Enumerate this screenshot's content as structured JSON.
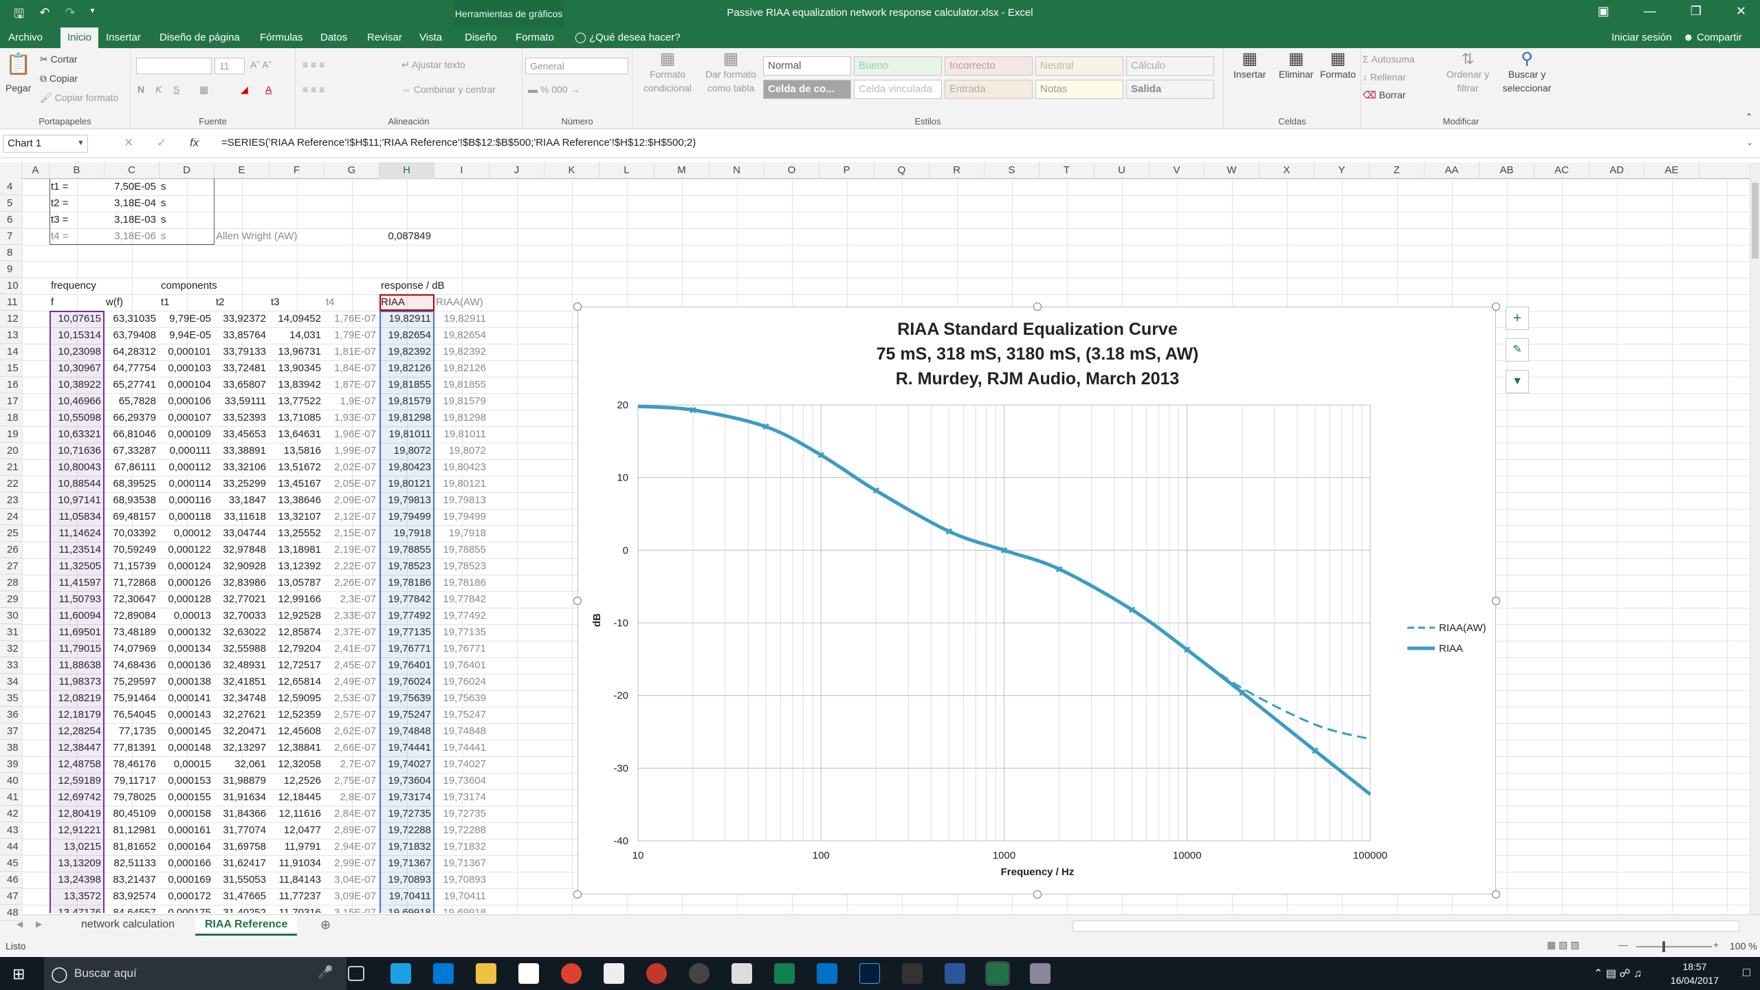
{
  "window": {
    "title": "Passive RIAA equalization network response calculator.xlsx - Excel",
    "context_tab": "Herramientas de gráficos"
  },
  "menu": {
    "tabs": [
      "Archivo",
      "Inicio",
      "Insertar",
      "Diseño de página",
      "Fórmulas",
      "Datos",
      "Revisar",
      "Vista",
      "Diseño",
      "Formato"
    ],
    "tell_me": "¿Qué desea hacer?",
    "signin": "Iniciar sesión",
    "share": "Compartir"
  },
  "ribbon": {
    "clipboard": {
      "paste": "Pegar",
      "cut": "Cortar",
      "copy": "Copiar",
      "format_painter": "Copiar formato",
      "group": "Portapapeles"
    },
    "font": {
      "size": "11",
      "group": "Fuente",
      "bold": "N",
      "italic": "K",
      "underline": "S"
    },
    "alignment": {
      "wrap": "Ajustar texto",
      "merge": "Combinar y centrar",
      "group": "Alineación"
    },
    "number": {
      "format": "General",
      "group": "Número"
    },
    "styles": {
      "conditional": "Formato condicional",
      "table": "Dar formato como tabla",
      "group": "Estilos",
      "cells": [
        "Normal",
        "Bueno",
        "Incorrecto",
        "Neutral",
        "Cálculo",
        "Celda de co...",
        "Celda vinculada",
        "Entrada",
        "Notas",
        "Salida"
      ]
    },
    "cells": {
      "insert": "Insertar",
      "delete": "Eliminar",
      "format": "Formato",
      "group": "Celdas"
    },
    "editing": {
      "autosum": "Autosuma",
      "fill": "Rellenar",
      "clear": "Borrar",
      "sort": "Ordenar y filtrar",
      "find": "Buscar y seleccionar",
      "group": "Modificar"
    }
  },
  "formula_bar": {
    "name_box": "Chart 1",
    "fx": "fx",
    "formula": "=SERIES('RIAA Reference'!$H$11;'RIAA Reference'!$B$12:$B$500;'RIAA Reference'!$H$12:$H$500;2)"
  },
  "columns": [
    "A",
    "B",
    "C",
    "D",
    "E",
    "F",
    "G",
    "H",
    "I",
    "J",
    "K",
    "L",
    "M",
    "N",
    "O",
    "P",
    "Q",
    "R",
    "S",
    "T",
    "U",
    "V",
    "W",
    "X",
    "Y",
    "Z",
    "AA",
    "AB",
    "AC",
    "AD",
    "AE"
  ],
  "row_numbers": [
    "4",
    "5",
    "6",
    "7",
    "8",
    "9",
    "10",
    "11",
    "12",
    "13",
    "14",
    "15",
    "16",
    "17",
    "18",
    "19",
    "20",
    "21",
    "22",
    "23",
    "24",
    "25",
    "26",
    "27",
    "28",
    "29",
    "30",
    "31",
    "32",
    "33",
    "34",
    "35",
    "36",
    "37",
    "38",
    "39",
    "40",
    "41",
    "42",
    "43",
    "44",
    "45",
    "46",
    "47",
    "48"
  ],
  "header_cells": {
    "t1_label": "t1 =",
    "t1_val": "7,50E-05",
    "t1_unit": "s",
    "t2_label": "t2 =",
    "t2_val": "3,18E-04",
    "t2_unit": "s",
    "t3_label": "t3 =",
    "t3_val": "3,18E-03",
    "t3_unit": "s",
    "t4_label": "t4 =",
    "t4_val": "3,18E-06",
    "t4_unit": "s",
    "aw_label": "Allen Wright (AW)",
    "aw_val": "0,087849",
    "frequency": "frequency",
    "components": "components",
    "response": "response / dB",
    "col_f": "f",
    "col_wf": "w(f)",
    "col_t1": "t1",
    "col_t2": "t2",
    "col_t3": "t3",
    "col_t4": "t4",
    "col_riaa": "RIAA",
    "col_riaa_aw": "RIAA(AW)"
  },
  "rows": [
    [
      "10,07615",
      "63,31035",
      "9,79E-05",
      "33,92372",
      "14,09452",
      "1,76E-07",
      "19,82911",
      "19,82911"
    ],
    [
      "10,15314",
      "63,79408",
      "9,94E-05",
      "33,85764",
      "14,031",
      "1,79E-07",
      "19,82654",
      "19,82654"
    ],
    [
      "10,23098",
      "64,28312",
      "0,000101",
      "33,79133",
      "13,96731",
      "1,81E-07",
      "19,82392",
      "19,82392"
    ],
    [
      "10,30967",
      "64,77754",
      "0,000103",
      "33,72481",
      "13,90345",
      "1,84E-07",
      "19,82126",
      "19,82126"
    ],
    [
      "10,38922",
      "65,27741",
      "0,000104",
      "33,65807",
      "13,83942",
      "1,87E-07",
      "19,81855",
      "19,81855"
    ],
    [
      "10,46966",
      "65,7828",
      "0,000106",
      "33,59111",
      "13,77522",
      "1,9E-07",
      "19,81579",
      "19,81579"
    ],
    [
      "10,55098",
      "66,29379",
      "0,000107",
      "33,52393",
      "13,71085",
      "1,93E-07",
      "19,81298",
      "19,81298"
    ],
    [
      "10,63321",
      "66,81046",
      "0,000109",
      "33,45653",
      "13,64631",
      "1,96E-07",
      "19,81011",
      "19,81011"
    ],
    [
      "10,71636",
      "67,33287",
      "0,000111",
      "33,38891",
      "13,5816",
      "1,99E-07",
      "19,8072",
      "19,8072"
    ],
    [
      "10,80043",
      "67,86111",
      "0,000112",
      "33,32106",
      "13,51672",
      "2,02E-07",
      "19,80423",
      "19,80423"
    ],
    [
      "10,88544",
      "68,39525",
      "0,000114",
      "33,25299",
      "13,45167",
      "2,05E-07",
      "19,80121",
      "19,80121"
    ],
    [
      "10,97141",
      "68,93538",
      "0,000116",
      "33,1847",
      "13,38646",
      "2,09E-07",
      "19,79813",
      "19,79813"
    ],
    [
      "11,05834",
      "69,48157",
      "0,000118",
      "33,11618",
      "13,32107",
      "2,12E-07",
      "19,79499",
      "19,79499"
    ],
    [
      "11,14624",
      "70,03392",
      "0,00012",
      "33,04744",
      "13,25552",
      "2,15E-07",
      "19,7918",
      "19,7918"
    ],
    [
      "11,23514",
      "70,59249",
      "0,000122",
      "32,97848",
      "13,18981",
      "2,19E-07",
      "19,78855",
      "19,78855"
    ],
    [
      "11,32505",
      "71,15739",
      "0,000124",
      "32,90928",
      "13,12392",
      "2,22E-07",
      "19,78523",
      "19,78523"
    ],
    [
      "11,41597",
      "71,72868",
      "0,000126",
      "32,83986",
      "13,05787",
      "2,26E-07",
      "19,78186",
      "19,78186"
    ],
    [
      "11,50793",
      "72,30647",
      "0,000128",
      "32,77021",
      "12,99166",
      "2,3E-07",
      "19,77842",
      "19,77842"
    ],
    [
      "11,60094",
      "72,89084",
      "0,00013",
      "32,70033",
      "12,92528",
      "2,33E-07",
      "19,77492",
      "19,77492"
    ],
    [
      "11,69501",
      "73,48189",
      "0,000132",
      "32,63022",
      "12,85874",
      "2,37E-07",
      "19,77135",
      "19,77135"
    ],
    [
      "11,79015",
      "74,07969",
      "0,000134",
      "32,55988",
      "12,79204",
      "2,41E-07",
      "19,76771",
      "19,76771"
    ],
    [
      "11,88638",
      "74,68436",
      "0,000136",
      "32,48931",
      "12,72517",
      "2,45E-07",
      "19,76401",
      "19,76401"
    ],
    [
      "11,98373",
      "75,29597",
      "0,000138",
      "32,41851",
      "12,65814",
      "2,49E-07",
      "19,76024",
      "19,76024"
    ],
    [
      "12,08219",
      "75,91464",
      "0,000141",
      "32,34748",
      "12,59095",
      "2,53E-07",
      "19,75639",
      "19,75639"
    ],
    [
      "12,18179",
      "76,54045",
      "0,000143",
      "32,27621",
      "12,52359",
      "2,57E-07",
      "19,75247",
      "19,75247"
    ],
    [
      "12,28254",
      "77,1735",
      "0,000145",
      "32,20471",
      "12,45608",
      "2,62E-07",
      "19,74848",
      "19,74848"
    ],
    [
      "12,38447",
      "77,81391",
      "0,000148",
      "32,13297",
      "12,38841",
      "2,66E-07",
      "19,74441",
      "19,74441"
    ],
    [
      "12,48758",
      "78,46176",
      "0,00015",
      "32,061",
      "12,32058",
      "2,7E-07",
      "19,74027",
      "19,74027"
    ],
    [
      "12,59189",
      "79,11717",
      "0,000153",
      "31,98879",
      "12,2526",
      "2,75E-07",
      "19,73604",
      "19,73604"
    ],
    [
      "12,69742",
      "79,78025",
      "0,000155",
      "31,91634",
      "12,18445",
      "2,8E-07",
      "19,73174",
      "19,73174"
    ],
    [
      "12,80419",
      "80,45109",
      "0,000158",
      "31,84366",
      "12,11616",
      "2,84E-07",
      "19,72735",
      "19,72735"
    ],
    [
      "12,91221",
      "81,12981",
      "0,000161",
      "31,77074",
      "12,0477",
      "2,89E-07",
      "19,72288",
      "19,72288"
    ],
    [
      "13,0215",
      "81,81652",
      "0,000164",
      "31,69758",
      "11,9791",
      "2,94E-07",
      "19,71832",
      "19,71832"
    ],
    [
      "13,13209",
      "82,51133",
      "0,000166",
      "31,62417",
      "11,91034",
      "2,99E-07",
      "19,71367",
      "19,71367"
    ],
    [
      "13,24398",
      "83,21437",
      "0,000169",
      "31,55053",
      "11,84143",
      "3,04E-07",
      "19,70893",
      "19,70893"
    ],
    [
      "13,3572",
      "83,92574",
      "0,000172",
      "31,47665",
      "11,77237",
      "3,09E-07",
      "19,70411",
      "19,70411"
    ],
    [
      "13,47176",
      "84,64557",
      "0,000175",
      "31,40252",
      "11,70316",
      "3,15E-07",
      "19,69918",
      "19,69918"
    ]
  ],
  "chart_data": {
    "type": "line",
    "title": "RIAA Standard Equalization Curve",
    "subtitle1": "75 mS, 318 mS, 3180 mS, (3.18 mS, AW)",
    "subtitle2": "R. Murdey, RJM Audio, March 2013",
    "xlabel": "Frequency / Hz",
    "ylabel": "dB",
    "x_scale": "log",
    "xlim": [
      10,
      100000
    ],
    "ylim": [
      -40,
      20
    ],
    "x_ticks": [
      "10",
      "100",
      "1000",
      "10000",
      "100000"
    ],
    "y_ticks": [
      "20",
      "10",
      "0",
      "-10",
      "-20",
      "-30",
      "-40"
    ],
    "grid": true,
    "legend": "right",
    "series": [
      {
        "name": "RIAA(AW)",
        "style": "dashed",
        "color": "#3a9cc4",
        "x": [
          10,
          20,
          50,
          100,
          200,
          500,
          1000,
          2000,
          5000,
          10000,
          20000,
          50000,
          100000
        ],
        "y": [
          19.8,
          19.3,
          17.0,
          13.1,
          8.2,
          2.6,
          0,
          -2.6,
          -8.2,
          -13.7,
          -19.0,
          -24.0,
          -26.0
        ]
      },
      {
        "name": "RIAA",
        "style": "solid",
        "color": "#3a9cc4",
        "x": [
          10,
          20,
          50,
          100,
          200,
          500,
          1000,
          2000,
          5000,
          10000,
          20000,
          50000,
          100000
        ],
        "y": [
          19.8,
          19.3,
          17.0,
          13.1,
          8.2,
          2.6,
          0,
          -2.6,
          -8.2,
          -13.7,
          -19.6,
          -27.6,
          -33.6
        ]
      }
    ]
  },
  "sheet_tabs": [
    "network calculation",
    "RIAA Reference"
  ],
  "status": {
    "ready": "Listo",
    "zoom": "100 %"
  },
  "taskbar": {
    "search": "Buscar aquí",
    "time": "18:57",
    "date": "16/04/2017"
  },
  "colors": {
    "excel_green": "#217346",
    "series": "#3a9cc4",
    "sel_purple": "#7030a0",
    "sel_blue": "#4472c4",
    "sel_red": "#c00000"
  }
}
